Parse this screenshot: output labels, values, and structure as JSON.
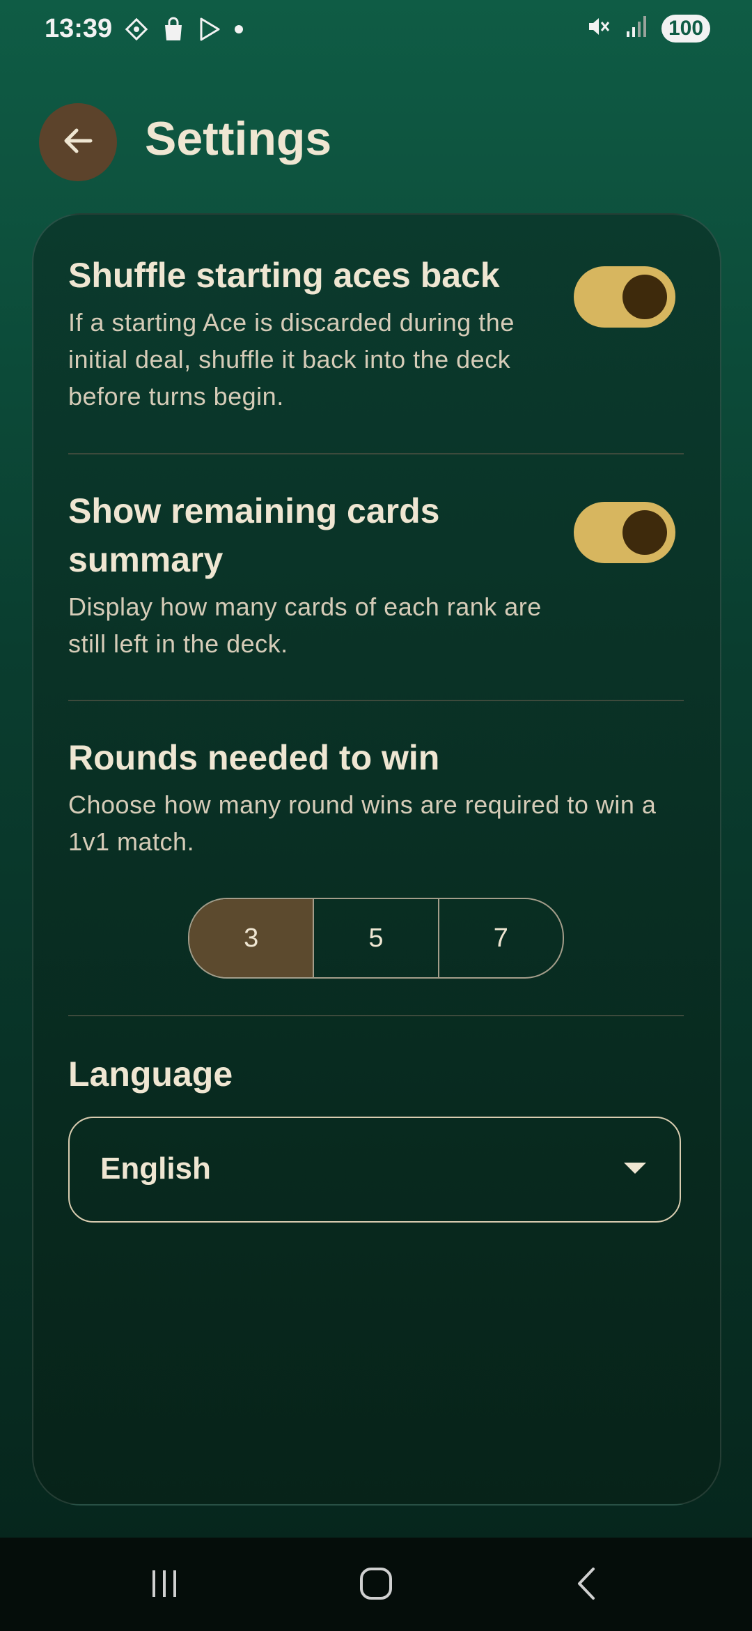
{
  "status_bar": {
    "time": "13:39",
    "battery": "100",
    "left_icons": [
      "settings-diamond-icon",
      "shopping-bag-icon",
      "play-store-icon",
      "dot-icon"
    ],
    "right_icons": [
      "mute-icon",
      "signal-icon"
    ]
  },
  "header": {
    "title": "Settings"
  },
  "settings": {
    "shuffle": {
      "title": "Shuffle starting aces back",
      "description": "If a starting Ace is discarded during the initial deal, shuffle it back into the deck before turns begin.",
      "enabled": true
    },
    "summary": {
      "title": "Show remaining cards summary",
      "description": "Display how many cards of each rank are still left in the deck.",
      "enabled": true
    },
    "rounds": {
      "title": "Rounds needed to win",
      "description": "Choose how many round wins are required to win a 1v1 match.",
      "options": [
        "3",
        "5",
        "7"
      ],
      "selected": "3"
    },
    "language": {
      "title": "Language",
      "value": "English"
    }
  },
  "colors": {
    "accent": "#d7b65f",
    "back_button": "#5c432b",
    "background_top": "#0f5c45",
    "background_bottom": "#06241b"
  }
}
